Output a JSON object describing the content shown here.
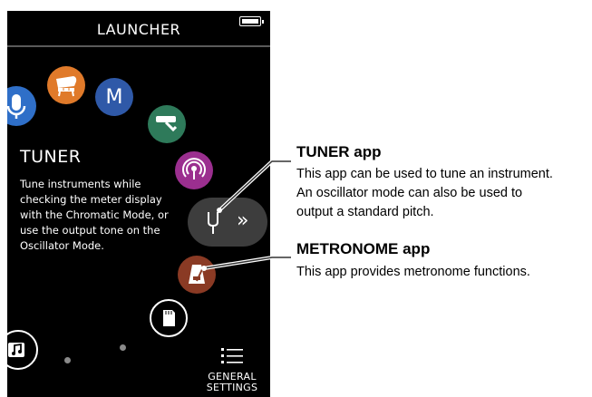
{
  "header": {
    "title": "LAUNCHER"
  },
  "selected_app": {
    "name": "TUNER",
    "description": "Tune instruments while checking the meter display with the Chromatic Mode, or use the output tone on the Oscillator Mode."
  },
  "app_icons": [
    {
      "name": "microphone-icon",
      "color": "#2f6fc8"
    },
    {
      "name": "piano-icon",
      "color": "#e07a2a"
    },
    {
      "name": "m-icon",
      "color": "#2f59a8",
      "glyph": "M"
    },
    {
      "name": "effect-icon",
      "color": "#2e7a5a"
    },
    {
      "name": "broadcast-icon",
      "color": "#9b2f8f"
    },
    {
      "name": "tuner-fork-icon",
      "color": "#3d3d3d"
    },
    {
      "name": "metronome-icon",
      "color": "#8a3a24"
    },
    {
      "name": "sd-card-icon",
      "color": "#000000"
    },
    {
      "name": "music-note-icon",
      "color": "#000000"
    }
  ],
  "selected_pill": {
    "chevron": "»"
  },
  "general_settings": {
    "label": "GENERAL\nSETTINGS"
  },
  "callouts": {
    "tuner": {
      "heading": "TUNER app",
      "lines": [
        "This app can be used to tune an instrument.",
        "An oscillator mode can also be used to",
        "output a standard pitch."
      ]
    },
    "metronome": {
      "heading": "METRONOME app",
      "lines": [
        "This app provides metronome functions."
      ]
    }
  }
}
